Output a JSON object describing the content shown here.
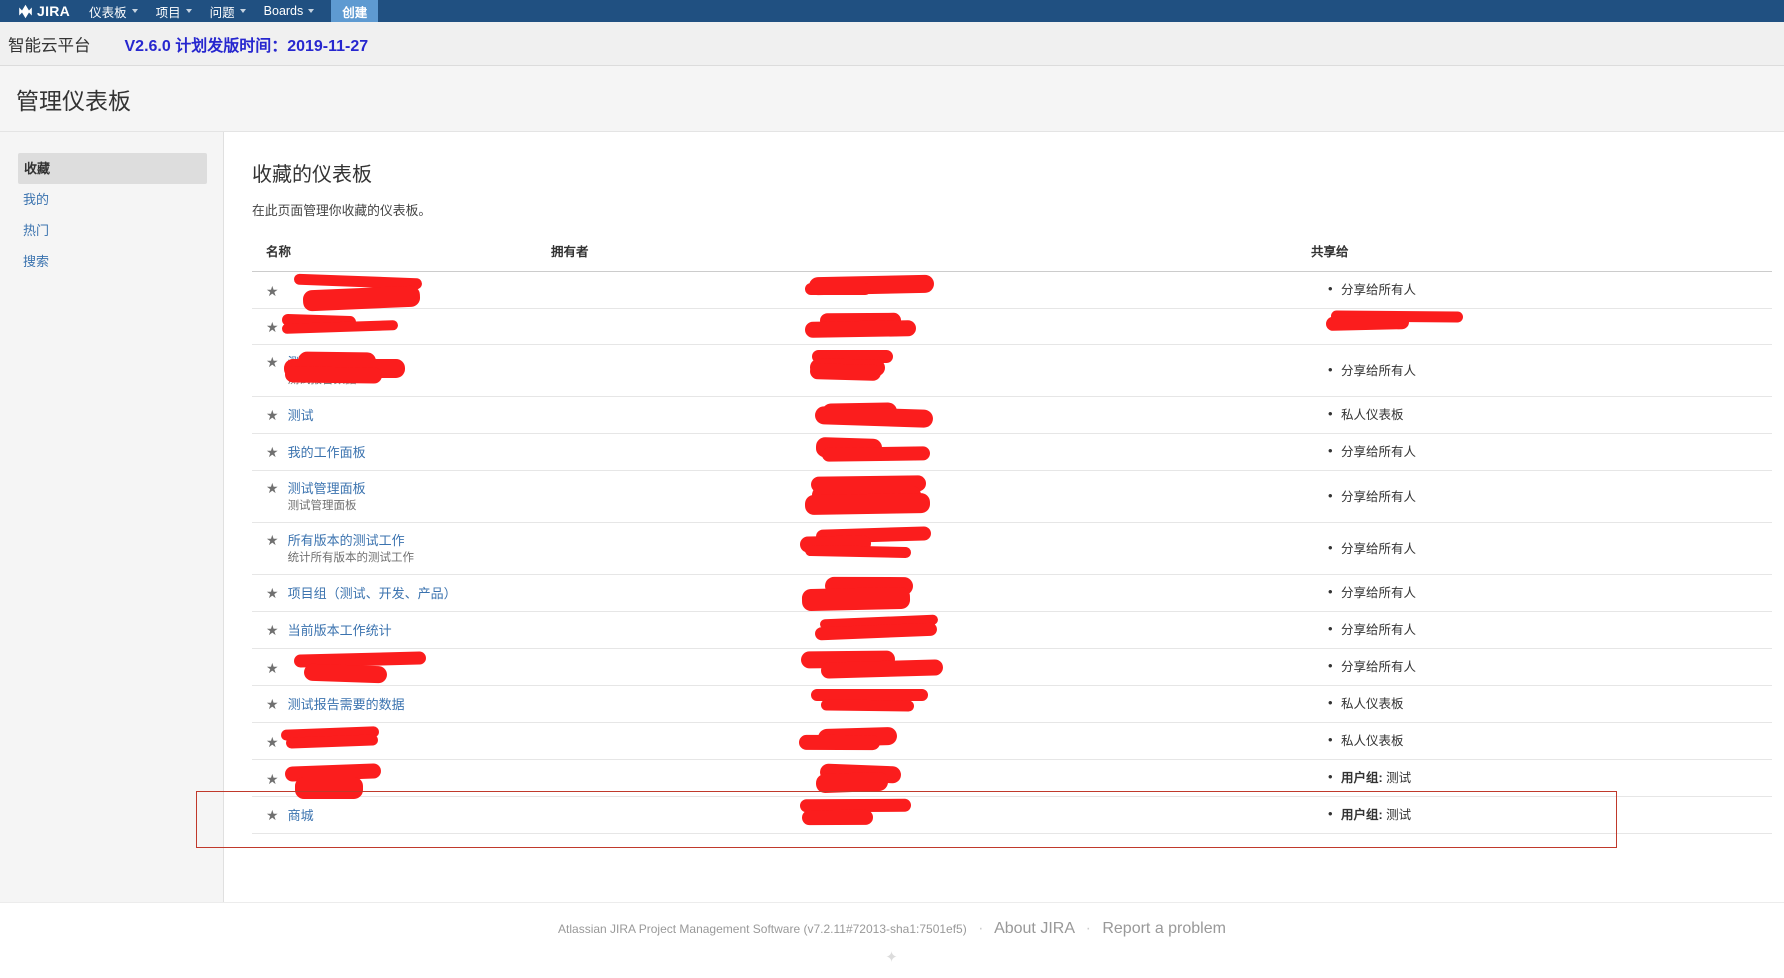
{
  "nav": {
    "logo_text": "JIRA",
    "logo_icon": "jira-logo-icon",
    "items": [
      {
        "label": "仪表板",
        "has_caret": true
      },
      {
        "label": "项目",
        "has_caret": true
      },
      {
        "label": "问题",
        "has_caret": true
      },
      {
        "label": "Boards",
        "has_caret": true
      }
    ],
    "create_label": "创建",
    "bar_color": "#205081",
    "create_color": "#5e9ad1"
  },
  "banner": {
    "project_name": "智能云平台",
    "version_note": "V2.6.0 计划发版时间：2019-11-27",
    "version_color": "#2727cf"
  },
  "page": {
    "title": "管理仪表板"
  },
  "sidebar": {
    "items": [
      {
        "label": "收藏",
        "active": true
      },
      {
        "label": "我的",
        "active": false
      },
      {
        "label": "热门",
        "active": false
      },
      {
        "label": "搜索",
        "active": false
      }
    ]
  },
  "main": {
    "heading": "收藏的仪表板",
    "description": "在此页面管理你收藏的仪表板。",
    "columns": {
      "name": "名称",
      "owner": "拥有者",
      "shared": "共享给"
    },
    "rows": [
      {
        "name": "",
        "desc": "",
        "name_redacted": true,
        "owner": "",
        "owner_redacted": true,
        "shared": "分享给所有人",
        "shared_label": "",
        "shared_redacted": false,
        "starred": true
      },
      {
        "name": "",
        "desc": "",
        "name_redacted": true,
        "owner": "",
        "owner_redacted": true,
        "shared": "",
        "shared_label": "",
        "shared_redacted": true,
        "starred": true
      },
      {
        "name": "测试",
        "desc": "测试报告数据",
        "name_redacted": true,
        "owner": "",
        "owner_redacted": true,
        "shared": "分享给所有人",
        "shared_label": "",
        "shared_redacted": false,
        "starred": true
      },
      {
        "name": "测试",
        "desc": "",
        "name_redacted": false,
        "owner": "",
        "owner_redacted": true,
        "shared": "私人仪表板",
        "shared_label": "",
        "shared_redacted": false,
        "starred": true
      },
      {
        "name": "我的工作面板",
        "desc": "",
        "name_redacted": false,
        "owner": "",
        "owner_redacted": true,
        "shared": "分享给所有人",
        "shared_label": "",
        "shared_redacted": false,
        "starred": true
      },
      {
        "name": "测试管理面板",
        "desc": "测试管理面板",
        "name_redacted": false,
        "owner": "",
        "owner_redacted": true,
        "shared": "分享给所有人",
        "shared_label": "",
        "shared_redacted": false,
        "starred": true
      },
      {
        "name": "所有版本的测试工作",
        "desc": "统计所有版本的测试工作",
        "name_redacted": false,
        "owner": "",
        "owner_redacted": true,
        "shared": "分享给所有人",
        "shared_label": "",
        "shared_redacted": false,
        "starred": true
      },
      {
        "name": "项目组（测试、开发、产品）",
        "desc": "",
        "name_redacted": false,
        "owner": "",
        "owner_redacted": true,
        "shared": "分享给所有人",
        "shared_label": "",
        "shared_redacted": false,
        "starred": true
      },
      {
        "name": "当前版本工作统计",
        "desc": "",
        "name_redacted": false,
        "owner": "",
        "owner_redacted": true,
        "shared": "分享给所有人",
        "shared_label": "",
        "shared_redacted": false,
        "starred": true
      },
      {
        "name": "",
        "desc": "",
        "name_redacted": true,
        "owner": "",
        "owner_redacted": true,
        "shared": "分享给所有人",
        "shared_label": "",
        "shared_redacted": false,
        "starred": true
      },
      {
        "name": "测试报告需要的数据",
        "desc": "",
        "name_redacted": false,
        "owner": "",
        "owner_redacted": true,
        "shared": "私人仪表板",
        "shared_label": "",
        "shared_redacted": false,
        "starred": true
      },
      {
        "name": "",
        "desc": "",
        "name_redacted": true,
        "owner": "",
        "owner_redacted": true,
        "shared": "私人仪表板",
        "shared_label": "",
        "shared_redacted": false,
        "starred": true
      },
      {
        "name": "",
        "desc": "",
        "name_redacted": true,
        "owner": "",
        "owner_redacted": true,
        "shared": "测试",
        "shared_label": "用户组",
        "shared_redacted": false,
        "starred": true
      },
      {
        "name": "商城",
        "desc": "",
        "name_redacted": false,
        "owner": "",
        "owner_redacted": true,
        "shared": "测试",
        "shared_label": "用户组",
        "shared_redacted": false,
        "starred": true,
        "highlighted": true
      }
    ]
  },
  "footer": {
    "software": "Atlassian JIRA Project Management Software (v7.2.11#72013-sha1:7501ef5)",
    "sep": "·",
    "about_label": "About JIRA",
    "report_label": "Report a problem"
  }
}
